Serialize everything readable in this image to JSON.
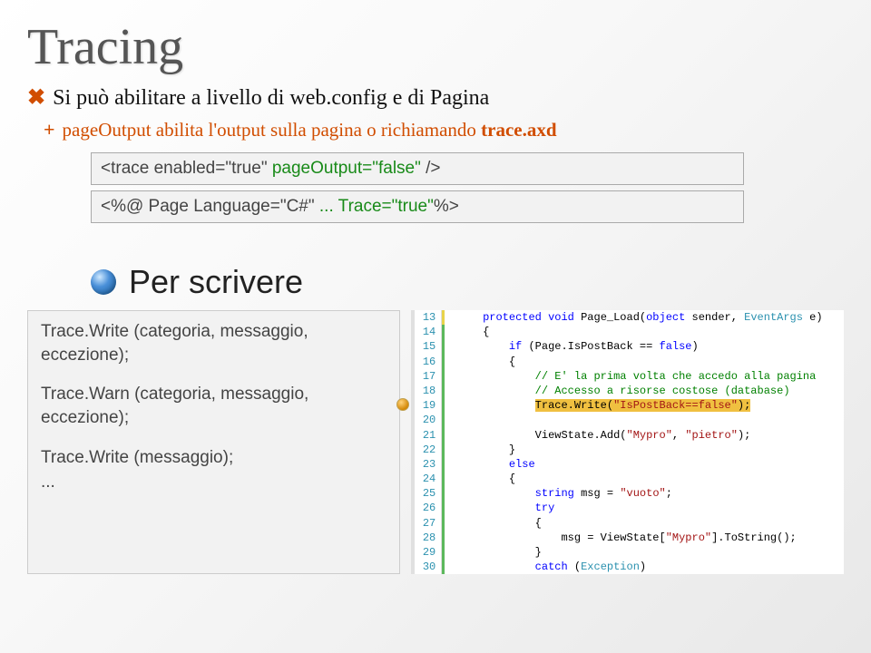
{
  "title": "Tracing",
  "bullet1": "Si può abilitare a livello di web.config e di Pagina",
  "bullet2_prefix": "pageOutput abilita l'output sulla pagina o richiamando ",
  "bullet2_bold": "trace.axd",
  "codebox1": {
    "pre": "<trace enabled=\"true\" ",
    "kw": "pageOutput=\"false\"",
    "post": " />"
  },
  "codebox2": {
    "pre": "<%@ Page Language=\"C#\" ",
    "kw": "... Trace=\"true\"",
    "post": "%>"
  },
  "subhead": "Per scrivere",
  "left": {
    "l1": "Trace.Write (categoria, messaggio, eccezione);",
    "l2": "Trace.Warn (categoria, messaggio, eccezione);",
    "l3": "Trace.Write (messaggio);",
    "l4": "..."
  },
  "code": {
    "13": {
      "indent": "    ",
      "t": [
        {
          "kw": "protected"
        },
        {
          "p": " "
        },
        {
          "kw": "void"
        },
        {
          "p": " Page_Load("
        },
        {
          "kw": "object"
        },
        {
          "p": " sender, "
        },
        {
          "ty": "EventArgs"
        },
        {
          "p": " e)"
        }
      ]
    },
    "14": {
      "indent": "    ",
      "t": [
        {
          "p": "{"
        }
      ]
    },
    "15": {
      "indent": "        ",
      "t": [
        {
          "kw": "if"
        },
        {
          "p": " (Page.IsPostBack == "
        },
        {
          "kw": "false"
        },
        {
          "p": ")"
        }
      ]
    },
    "16": {
      "indent": "        ",
      "t": [
        {
          "p": "{"
        }
      ]
    },
    "17": {
      "indent": "            ",
      "t": [
        {
          "com": "// E' la prima volta che accedo alla pagina"
        }
      ]
    },
    "18": {
      "indent": "            ",
      "t": [
        {
          "com": "// Accesso a risorse costose (database)"
        }
      ]
    },
    "19": {
      "indent": "            ",
      "hl": true,
      "t": [
        {
          "p": "Trace.Write("
        },
        {
          "str": "\"IsPostBack==false\""
        },
        {
          "p": ");"
        }
      ]
    },
    "20": {
      "indent": "",
      "t": [
        {
          "p": ""
        }
      ]
    },
    "21": {
      "indent": "            ",
      "t": [
        {
          "p": "ViewState.Add("
        },
        {
          "str": "\"Mypro\""
        },
        {
          "p": ", "
        },
        {
          "str": "\"pietro\""
        },
        {
          "p": ");"
        }
      ]
    },
    "22": {
      "indent": "        ",
      "t": [
        {
          "p": "}"
        }
      ]
    },
    "23": {
      "indent": "        ",
      "t": [
        {
          "kw": "else"
        }
      ]
    },
    "24": {
      "indent": "        ",
      "t": [
        {
          "p": "{"
        }
      ]
    },
    "25": {
      "indent": "            ",
      "t": [
        {
          "kw": "string"
        },
        {
          "p": " msg = "
        },
        {
          "str": "\"vuoto\""
        },
        {
          "p": ";"
        }
      ]
    },
    "26": {
      "indent": "            ",
      "t": [
        {
          "kw": "try"
        }
      ]
    },
    "27": {
      "indent": "            ",
      "t": [
        {
          "p": "{"
        }
      ]
    },
    "28": {
      "indent": "                ",
      "t": [
        {
          "p": "msg = ViewState["
        },
        {
          "str": "\"Mypro\""
        },
        {
          "p": "].ToString();"
        }
      ]
    },
    "29": {
      "indent": "            ",
      "t": [
        {
          "p": "}"
        }
      ]
    },
    "30": {
      "indent": "            ",
      "t": [
        {
          "kw": "catch"
        },
        {
          "p": " ("
        },
        {
          "ty": "Exception"
        },
        {
          "p": ")"
        }
      ]
    }
  },
  "lineOrder": [
    "13",
    "14",
    "15",
    "16",
    "17",
    "18",
    "19",
    "20",
    "21",
    "22",
    "23",
    "24",
    "25",
    "26",
    "27",
    "28",
    "29",
    "30"
  ],
  "marginColors": {
    "13": "yellow",
    "14": "green",
    "15": "green",
    "16": "green",
    "17": "green",
    "18": "green",
    "19": "green",
    "20": "green",
    "21": "green",
    "22": "green",
    "23": "green",
    "24": "green",
    "25": "green",
    "26": "green",
    "27": "green",
    "28": "green",
    "29": "green",
    "30": "green"
  }
}
